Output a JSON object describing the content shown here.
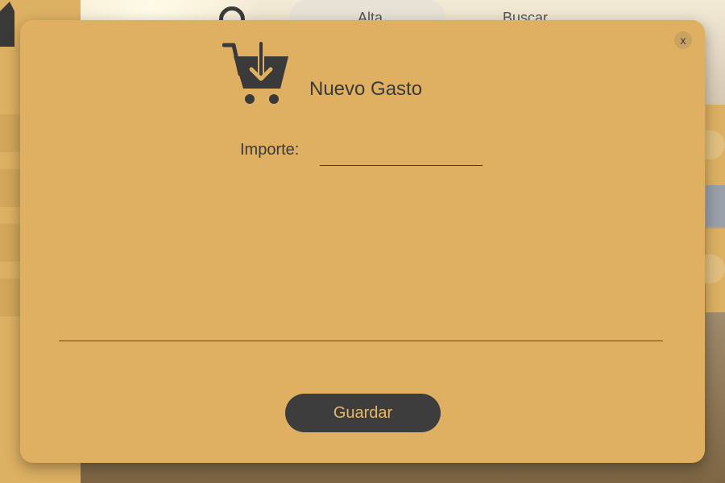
{
  "background": {
    "top_nav": {
      "tab_1": "Alta",
      "tab_2": "Buscar"
    },
    "sidebar_item_count": 4
  },
  "modal": {
    "title": "Nuevo Gasto",
    "close_label": "x",
    "icon": "cart-download-icon",
    "fields": {
      "importe": {
        "label": "Importe:",
        "value": "",
        "placeholder": ""
      }
    },
    "save_label": "Guardar"
  },
  "colors": {
    "accent": "#dfb062",
    "text_dark": "#3a3a3a",
    "button_bg": "#3d3d3d",
    "button_text": "#e7b763"
  }
}
